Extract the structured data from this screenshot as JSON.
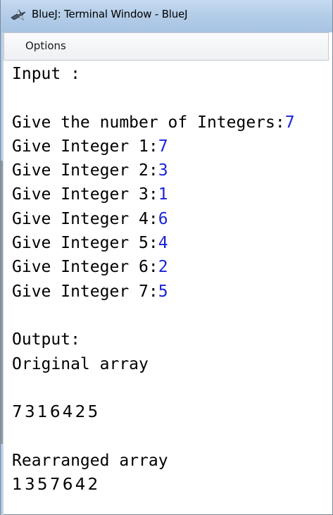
{
  "window": {
    "title": "BlueJ: Terminal Window - BlueJ",
    "icon": "bluej-bird-icon"
  },
  "menu": {
    "items": [
      "Options"
    ]
  },
  "terminal": {
    "lines": [
      {
        "text": "Input :",
        "input": ""
      },
      {
        "text": "",
        "input": ""
      },
      {
        "text": "Give the number of Integers:",
        "input": "7"
      },
      {
        "text": "Give Integer 1:",
        "input": "7"
      },
      {
        "text": "Give Integer 2:",
        "input": "3"
      },
      {
        "text": "Give Integer 3:",
        "input": "1"
      },
      {
        "text": "Give Integer 4:",
        "input": "6"
      },
      {
        "text": "Give Integer 5:",
        "input": "4"
      },
      {
        "text": "Give Integer 6:",
        "input": "2"
      },
      {
        "text": "Give Integer 7:",
        "input": "5"
      },
      {
        "text": "",
        "input": ""
      },
      {
        "text": "Output:",
        "input": ""
      },
      {
        "text": "Original array",
        "input": ""
      },
      {
        "text": "",
        "input": ""
      },
      {
        "text": "7 3 1 6 4 2 5",
        "input": ""
      },
      {
        "text": "",
        "input": ""
      },
      {
        "text": "Rearranged array",
        "input": ""
      },
      {
        "text": "1 3 5 7 6 4 2",
        "input": ""
      }
    ]
  },
  "colors": {
    "input_text": "#1b22d9",
    "output_text": "#000000",
    "titlebar": "#b4cde8"
  }
}
